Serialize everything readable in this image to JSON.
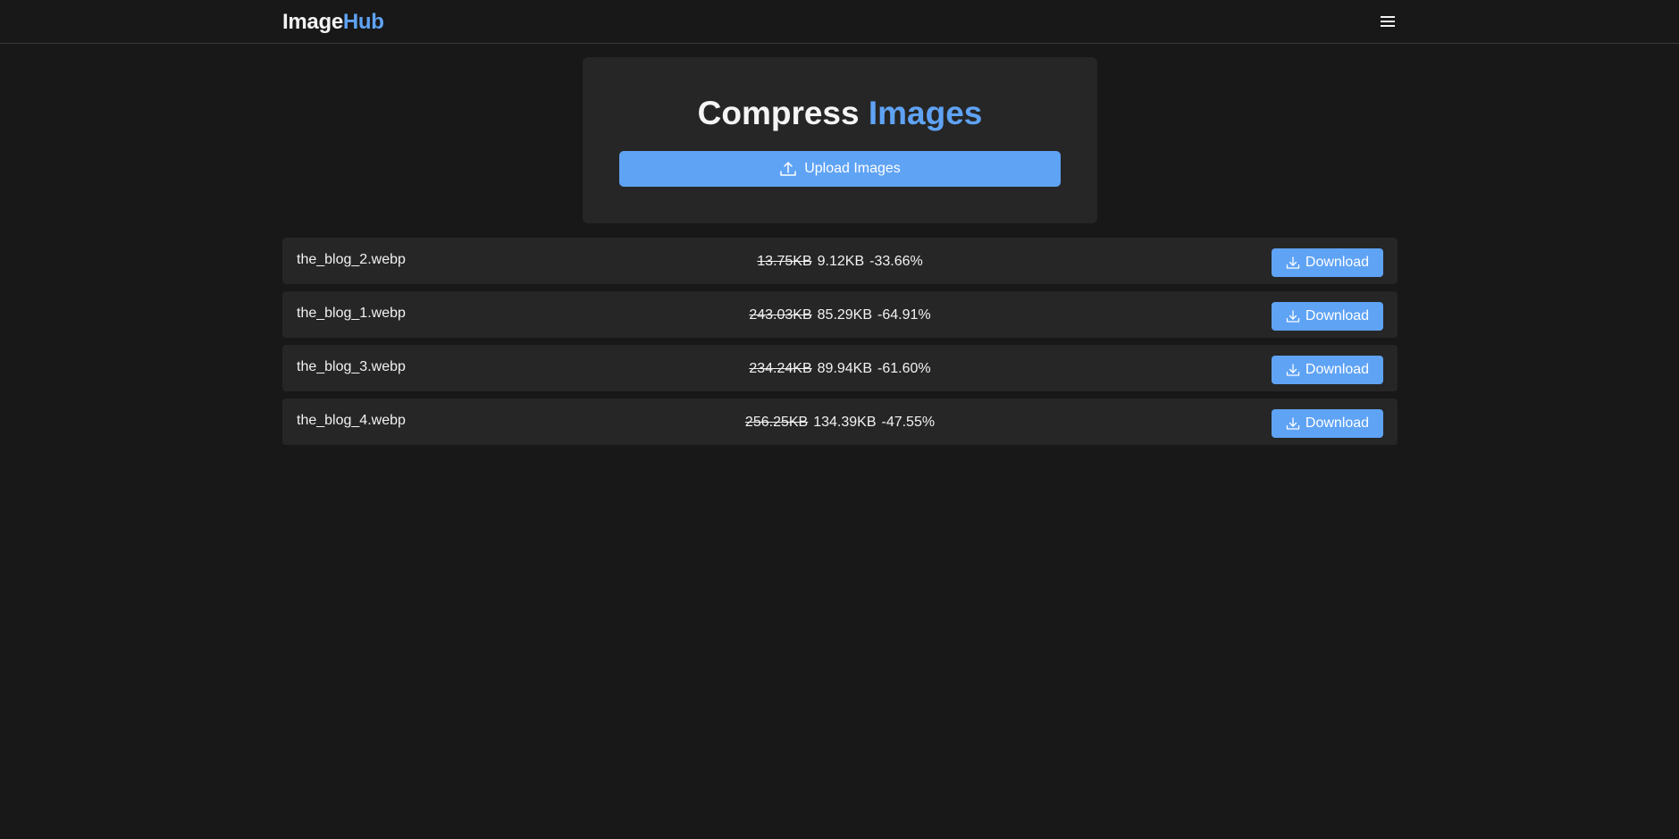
{
  "header": {
    "logo_main": "Image",
    "logo_accent": "Hub",
    "menu_icon": "hamburger-menu-icon"
  },
  "card": {
    "title_main": "Compress",
    "title_accent": "Images",
    "upload_label": "Upload Images",
    "upload_icon": "upload-icon"
  },
  "files": [
    {
      "name": "the_blog_2.webp",
      "original": "13.75KB",
      "compressed": "9.12KB",
      "reduction": "-33.66%",
      "button": "Download"
    },
    {
      "name": "the_blog_1.webp",
      "original": "243.03KB",
      "compressed": "85.29KB",
      "reduction": "-64.91%",
      "button": "Download"
    },
    {
      "name": "the_blog_3.webp",
      "original": "234.24KB",
      "compressed": "89.94KB",
      "reduction": "-61.60%",
      "button": "Download"
    },
    {
      "name": "the_blog_4.webp",
      "original": "256.25KB",
      "compressed": "134.39KB",
      "reduction": "-47.55%",
      "button": "Download"
    }
  ],
  "colors": {
    "background": "#181818",
    "panel": "#262626",
    "accent": "#5fa3f5",
    "text": "#f2f2f2"
  }
}
